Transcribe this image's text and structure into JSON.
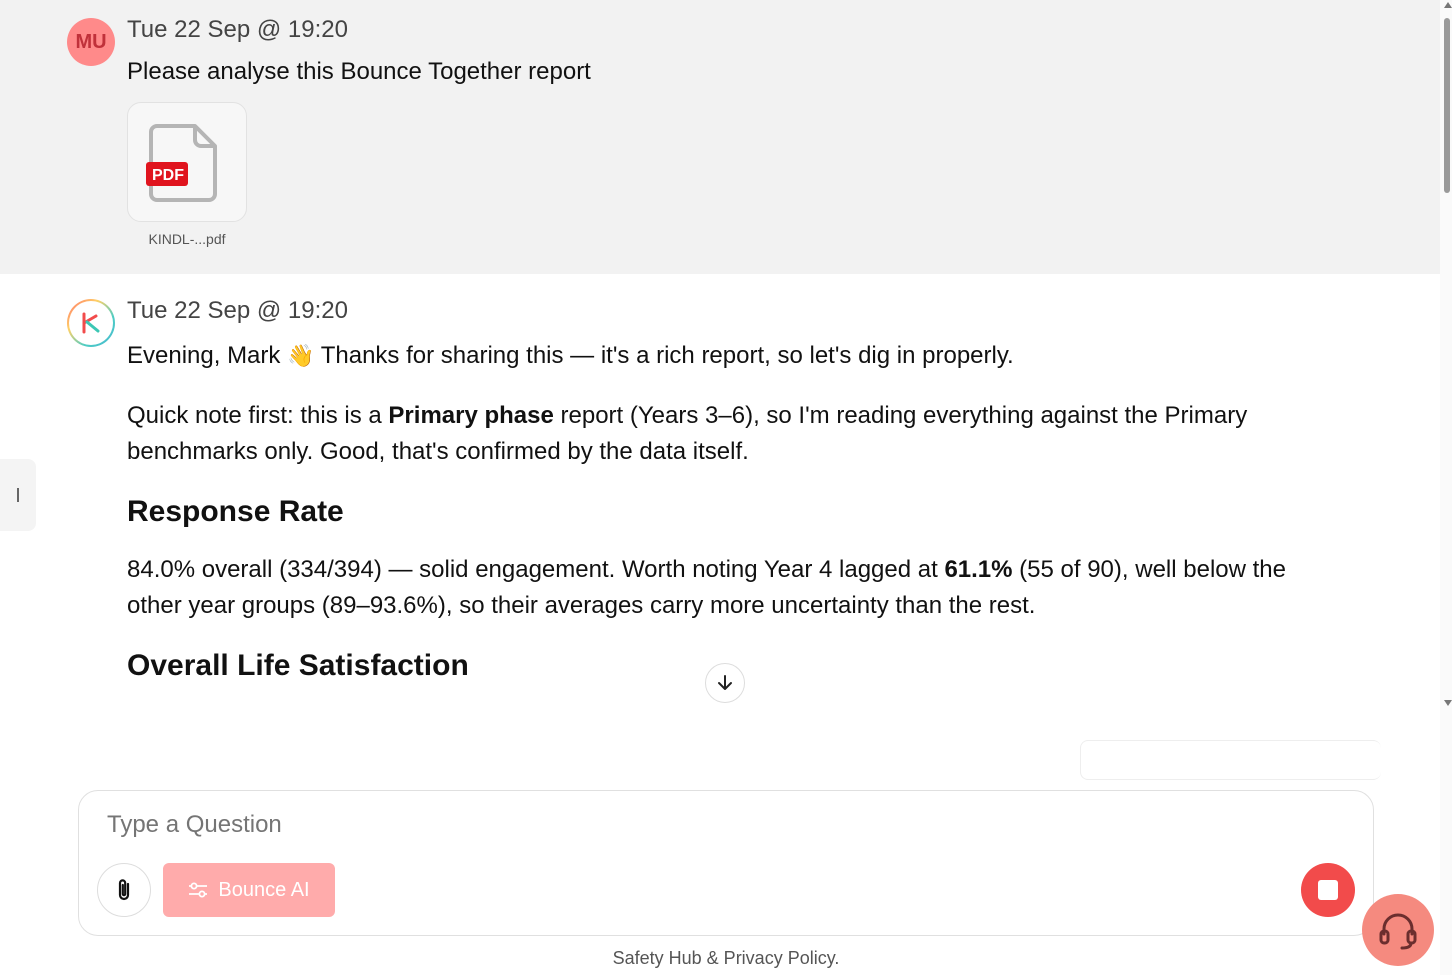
{
  "user_message": {
    "avatar_initials": "MU",
    "timestamp": "Tue 22 Sep @ 19:20",
    "text": "Please analyse this Bounce Together report",
    "attachment": {
      "type_badge": "PDF",
      "filename": "KINDL-...pdf"
    }
  },
  "ai_message": {
    "timestamp": "Tue 22 Sep @ 19:20",
    "greeting_a": "Evening, Mark",
    "greeting_emoji": "👋",
    "greeting_b": " Thanks for sharing this — it's a rich report, so let's dig in properly.",
    "note_a": "Quick note first: this is a ",
    "note_bold": "Primary phase",
    "note_b": " report (Years 3–6), so I'm reading everything against the Primary benchmarks only. Good, that's confirmed by the data itself.",
    "heading_response": "Response Rate",
    "response_a": "84.0% overall (334/394) — solid engagement. Worth noting Year 4 lagged at ",
    "response_bold": "61.1%",
    "response_b": " (55 of 90), well below the other year groups (89–93.6%), so their averages carry more uncertainty than the rest.",
    "heading_life": "Overall Life Satisfaction"
  },
  "composer": {
    "placeholder": "Type a Question",
    "mode_label": "Bounce AI"
  },
  "footer": {
    "text": "Safety Hub & Privacy Policy."
  },
  "colors": {
    "accent": "#f24b4b",
    "mode_button": "#ffabab",
    "support": "#f58a7f",
    "user_bg": "#f2f2f2",
    "pdf_red": "#e0141e"
  }
}
